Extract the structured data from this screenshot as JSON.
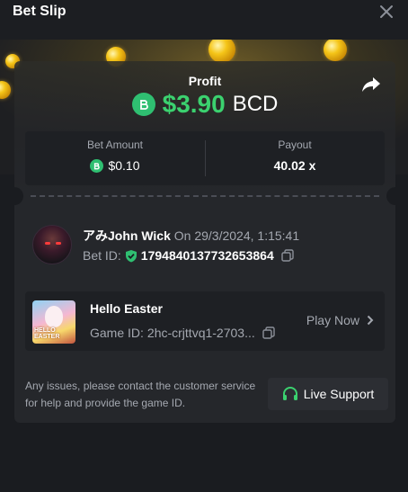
{
  "header": {
    "title": "Bet Slip"
  },
  "profit": {
    "label": "Profit",
    "amount": "$3.90",
    "currency": "BCD"
  },
  "stats": {
    "bet_amount_label": "Bet Amount",
    "bet_amount_value": "$0.10",
    "payout_label": "Payout",
    "payout_value": "40.02 x"
  },
  "user": {
    "name": "アみJohn Wick",
    "date": "On 29/3/2024, 1:15:41",
    "bet_id_label": "Bet ID:",
    "bet_id": "1794840137732653864"
  },
  "game": {
    "thumbnail_text": "HELLO EASTER",
    "name": "Hello Easter",
    "id_label": "Game ID:",
    "id": "2hc-crjttvq1-2703...",
    "play_label": "Play Now"
  },
  "footer": {
    "note": "Any issues, please contact the customer service for help and provide the game ID.",
    "support_label": "Live Support"
  },
  "colors": {
    "accent_green": "#3bd16f",
    "bcd_icon": "#2fbf71",
    "background": "#1a1c20",
    "card": "#25272b"
  }
}
